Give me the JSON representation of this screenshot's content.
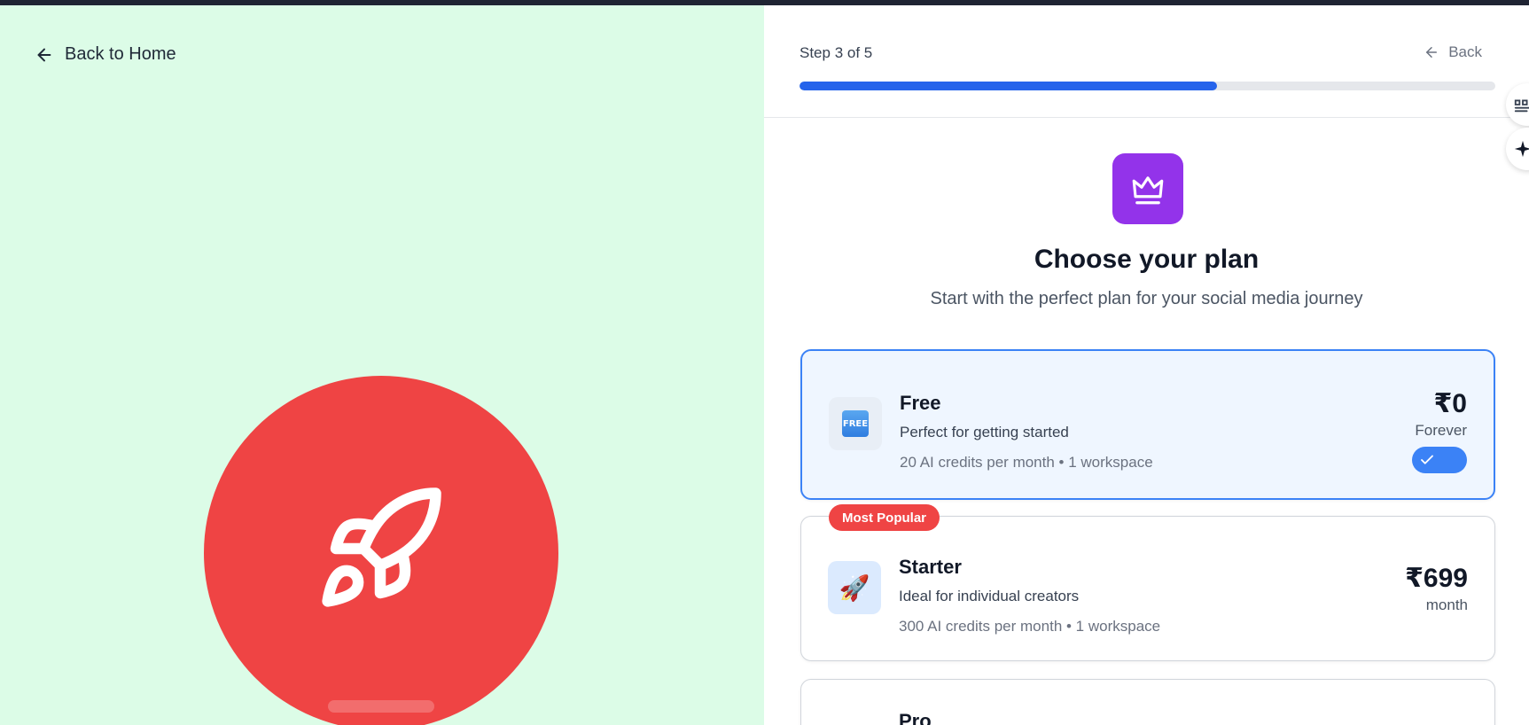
{
  "left_panel": {
    "back_link": "Back to Home"
  },
  "header": {
    "step": "Step 3 of 5",
    "back": "Back",
    "progress": 0.6
  },
  "intro": {
    "title": "Choose your plan",
    "subtitle": "Start with the perfect plan for your social media journey"
  },
  "plans": [
    {
      "name": "Free",
      "description": "Perfect for getting started",
      "features": "20 AI credits per month • 1 workspace",
      "price": "₹0",
      "period": "Forever",
      "icon": "free-icon",
      "icon_text": "FREE",
      "selected": true
    },
    {
      "badge": "Most Popular",
      "name": "Starter",
      "description": "Ideal for individual creators",
      "features": "300 AI credits per month • 1 workspace",
      "price": "₹699",
      "period": "month",
      "icon": "rocket-icon",
      "icon_text": "🚀",
      "selected": false
    },
    {
      "name": "Pro"
    }
  ],
  "colors": {
    "left_bg": "#dcfce7",
    "accent": "#2563eb",
    "crown_bg": "#9333ea",
    "rocket_bg": "#ef4444",
    "badge_bg": "#ef4444"
  }
}
